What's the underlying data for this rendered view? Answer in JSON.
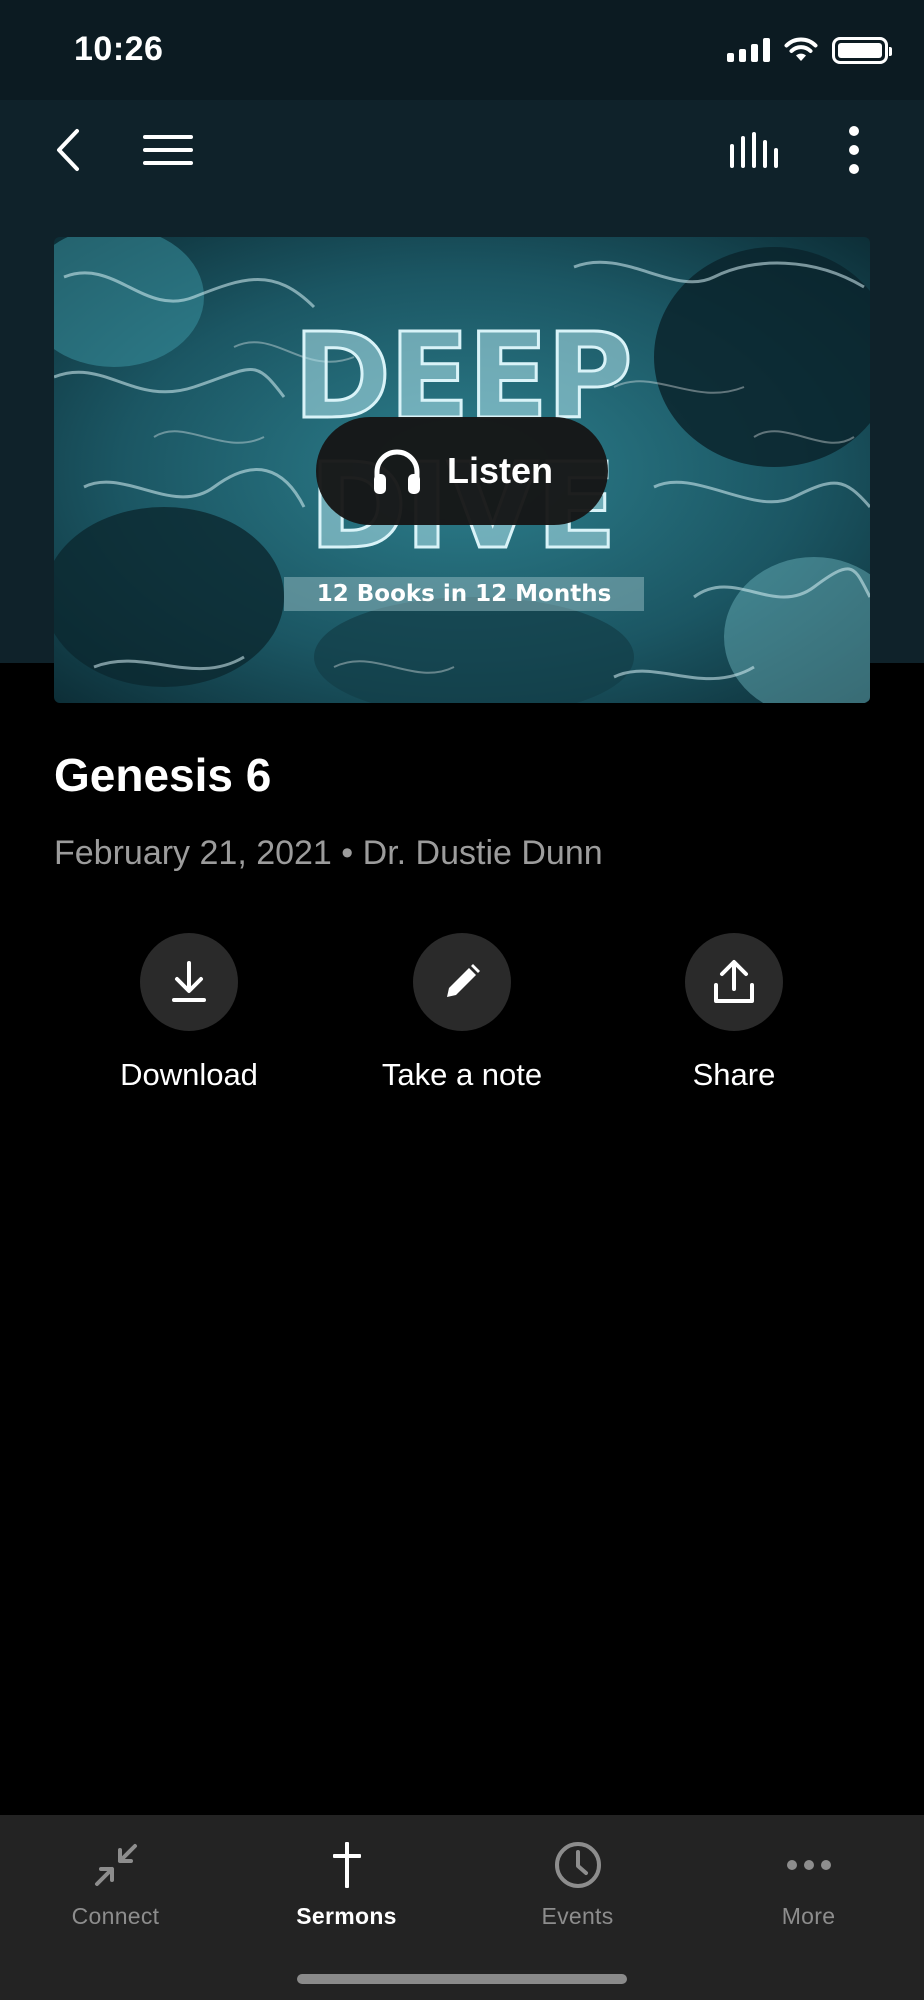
{
  "status_bar": {
    "time": "10:26"
  },
  "hero": {
    "title_line1": "DEEP",
    "title_line2": "DIVE",
    "subtitle": "12 Books in 12 Months",
    "listen_label": "Listen"
  },
  "sermon": {
    "title": "Genesis 6",
    "meta": "February 21, 2021 • Dr. Dustie Dunn"
  },
  "actions": [
    {
      "label": "Download",
      "icon": "download-icon"
    },
    {
      "label": "Take a note",
      "icon": "pencil-icon"
    },
    {
      "label": "Share",
      "icon": "share-icon"
    }
  ],
  "tabs": [
    {
      "label": "Connect",
      "icon": "connect-arrows-icon",
      "active": false
    },
    {
      "label": "Sermons",
      "icon": "cross-icon",
      "active": true
    },
    {
      "label": "Events",
      "icon": "clock-icon",
      "active": false
    },
    {
      "label": "More",
      "icon": "more-dots-icon",
      "active": false
    }
  ],
  "colors": {
    "header_bg": "#0f222a",
    "background": "#000000",
    "tabbar_bg": "#232323",
    "action_circle": "#2a2a2a",
    "muted_text": "#9c9c9c"
  }
}
